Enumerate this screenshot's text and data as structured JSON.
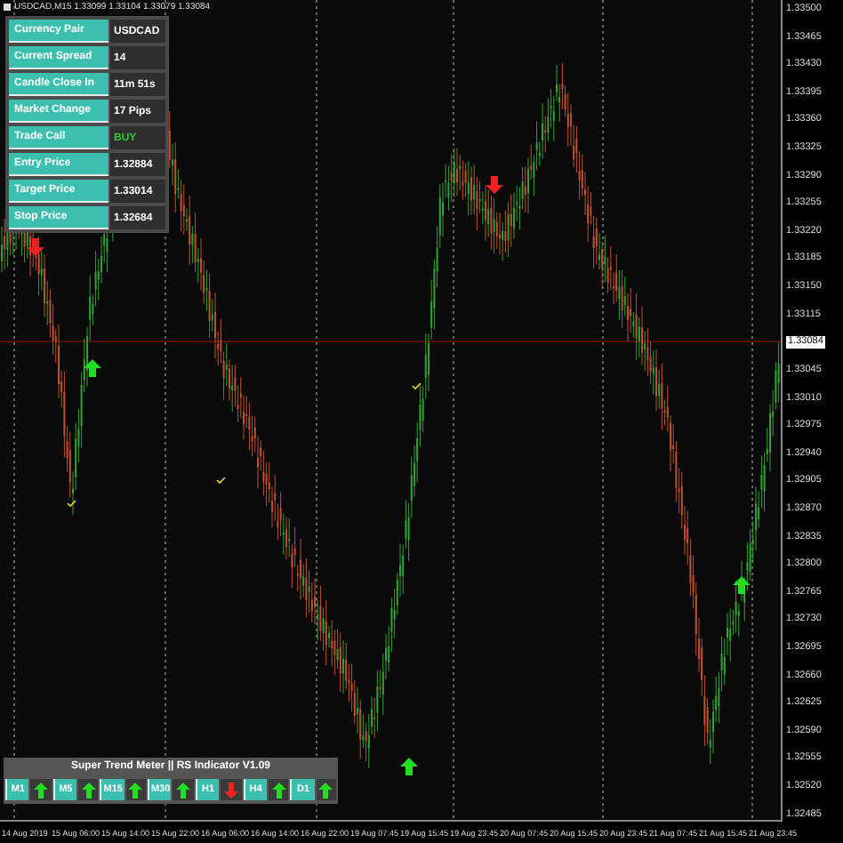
{
  "chart_header": "USDCAD,M15  1.33099 1.33104 1.33079 1.33084",
  "info_panel": [
    {
      "label": "Currency Pair",
      "value": "USDCAD",
      "kind": "plain"
    },
    {
      "label": "Current Spread",
      "value": "14",
      "kind": "plain"
    },
    {
      "label": "Candle Close In",
      "value": "11m 51s",
      "kind": "plain"
    },
    {
      "label": "Market Change",
      "value": "17 Pips",
      "kind": "plain"
    },
    {
      "label": "Trade Call",
      "value": "BUY",
      "kind": "buy"
    },
    {
      "label": "Entry Price",
      "value": "1.32884",
      "kind": "plain"
    },
    {
      "label": "Target Price",
      "value": "1.33014",
      "kind": "plain"
    },
    {
      "label": "Stop Price",
      "value": "1.32684",
      "kind": "plain"
    }
  ],
  "trend_meter": {
    "title": "Super Trend Meter  ||  RS Indicator V1.09",
    "timeframes": [
      {
        "label": "M1",
        "trend_up": true
      },
      {
        "label": "M5",
        "trend_up": true
      },
      {
        "label": "M15",
        "trend_up": true
      },
      {
        "label": "M30",
        "trend_up": true
      },
      {
        "label": "H1",
        "trend_up": false
      },
      {
        "label": "H4",
        "trend_up": true
      },
      {
        "label": "D1",
        "trend_up": true
      }
    ]
  },
  "price_axis": [
    {
      "label": "1.33500",
      "kind": "tick"
    },
    {
      "label": "1.33465",
      "kind": "tick"
    },
    {
      "label": "1.33430",
      "kind": "tick"
    },
    {
      "label": "1.33395",
      "kind": "tick"
    },
    {
      "label": "1.33360",
      "kind": "tick"
    },
    {
      "label": "1.33325",
      "kind": "tick"
    },
    {
      "label": "1.33290",
      "kind": "tick"
    },
    {
      "label": "1.33255",
      "kind": "tick"
    },
    {
      "label": "1.33220",
      "kind": "tick"
    },
    {
      "label": "1.33185",
      "kind": "tick"
    },
    {
      "label": "1.33150",
      "kind": "tick"
    },
    {
      "label": "1.33115",
      "kind": "tick"
    },
    {
      "label": "1.33084",
      "kind": "current"
    },
    {
      "label": "1.33045",
      "kind": "tick"
    },
    {
      "label": "1.33010",
      "kind": "tick"
    },
    {
      "label": "1.32975",
      "kind": "tick"
    },
    {
      "label": "1.32940",
      "kind": "tick"
    },
    {
      "label": "1.32905",
      "kind": "tick"
    },
    {
      "label": "1.32870",
      "kind": "tick"
    },
    {
      "label": "1.32835",
      "kind": "tick"
    },
    {
      "label": "1.32800",
      "kind": "tick"
    },
    {
      "label": "1.32765",
      "kind": "tick"
    },
    {
      "label": "1.32730",
      "kind": "tick"
    },
    {
      "label": "1.32695",
      "kind": "tick"
    },
    {
      "label": "1.32660",
      "kind": "tick"
    },
    {
      "label": "1.32625",
      "kind": "tick"
    },
    {
      "label": "1.32590",
      "kind": "tick"
    },
    {
      "label": "1.32555",
      "kind": "tick"
    },
    {
      "label": "1.32520",
      "kind": "tick"
    },
    {
      "label": "1.32485",
      "kind": "tick"
    }
  ],
  "time_axis": [
    "14 Aug 2019",
    "15 Aug 06:00",
    "15 Aug 14:00",
    "15 Aug 22:00",
    "16 Aug 06:00",
    "16 Aug 14:00",
    "16 Aug 22:00",
    "19 Aug 07:45",
    "19 Aug 15:45",
    "19 Aug 23:45",
    "20 Aug 07:45",
    "20 Aug 15:45",
    "20 Aug 23:45",
    "21 Aug 07:45",
    "21 Aug 15:45",
    "21 Aug 23:45"
  ]
}
